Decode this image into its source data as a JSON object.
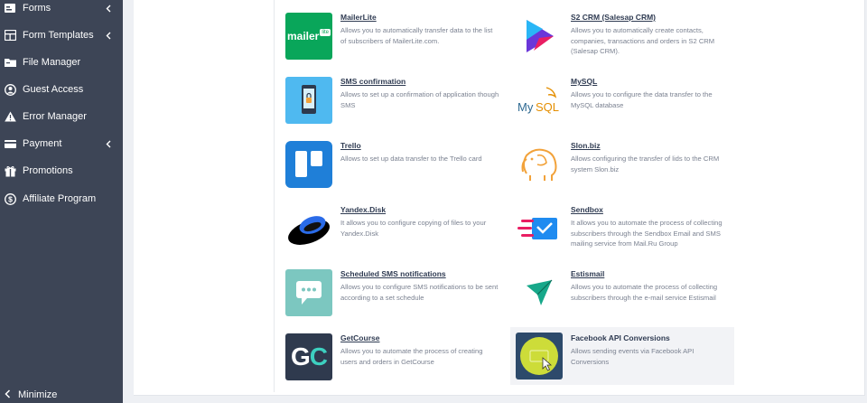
{
  "sidebar": {
    "items": [
      {
        "label": "Forms",
        "icon": "forms-icon",
        "has_submenu": true
      },
      {
        "label": "Form Templates",
        "icon": "form-templates-icon",
        "has_submenu": true
      },
      {
        "label": "File Manager",
        "icon": "file-manager-icon",
        "has_submenu": false
      },
      {
        "label": "Guest Access",
        "icon": "user-circle-icon",
        "has_submenu": false
      },
      {
        "label": "Error Manager",
        "icon": "warning-icon",
        "has_submenu": false
      },
      {
        "label": "Payment",
        "icon": "credit-card-icon",
        "has_submenu": true
      },
      {
        "label": "Promotions",
        "icon": "gift-icon",
        "has_submenu": false
      },
      {
        "label": "Affiliate Program",
        "icon": "dollar-icon",
        "has_submenu": false
      }
    ],
    "minimize_label": "Minimize"
  },
  "integrations": [
    {
      "title": "MailerLite",
      "description": "Allows you to automatically transfer data to the list of subscribers of MailerLite.com.",
      "logo_text": "mailer",
      "logo_badge": "lite",
      "color": "#09a65a"
    },
    {
      "title": "S2 CRM (Salesap CRM)",
      "description": "Allows you to automatically create contacts, companies, transactions and orders in S2 CRM (Salesap CRM).",
      "color": "#6a36d9"
    },
    {
      "title": "SMS confirmation",
      "description": "Allows to set up a confirmation of application though SMS",
      "color": "#4fb9f0"
    },
    {
      "title": "MySQL",
      "description": "Allows you to configure the data transfer to the MySQL database",
      "logo_text": "MySQL",
      "color": "#2f6a92"
    },
    {
      "title": "Trello",
      "description": "Allows to set up data transfer to the Trello card",
      "color": "#1f7fd8"
    },
    {
      "title": "Slon.biz",
      "description": "Allows configuring the transfer of lids to the CRM system Slon.biz",
      "color": "#f2a23a"
    },
    {
      "title": "Yandex.Disk",
      "description": "It allows you to configure copying of files to your Yandex.Disk",
      "color": "#2a6be8"
    },
    {
      "title": "Sendbox",
      "description": "It allows you to automate the process of collecting subscribers through the Sendbox Email and SMS mailing service from Mail.Ru Group",
      "color": "#1f8bf0"
    },
    {
      "title": "Scheduled SMS notifications",
      "description": "Allows you to configure SMS notifications to be sent according to a set schedule",
      "color": "#7cc7c0"
    },
    {
      "title": "Estismail",
      "description": "Allows you to automate the process of collecting subscribers through the e-mail service Estismail",
      "color": "#17a88a"
    },
    {
      "title": "GetCourse",
      "description": "Allows you to automate the process of creating users and orders in GetCourse",
      "logo_text": "GC",
      "color": "#2f3a4e"
    },
    {
      "title": "Facebook API Conversions",
      "description": "Allows sending events via Facebook API Conversions",
      "color": "#2d4a6b"
    }
  ]
}
